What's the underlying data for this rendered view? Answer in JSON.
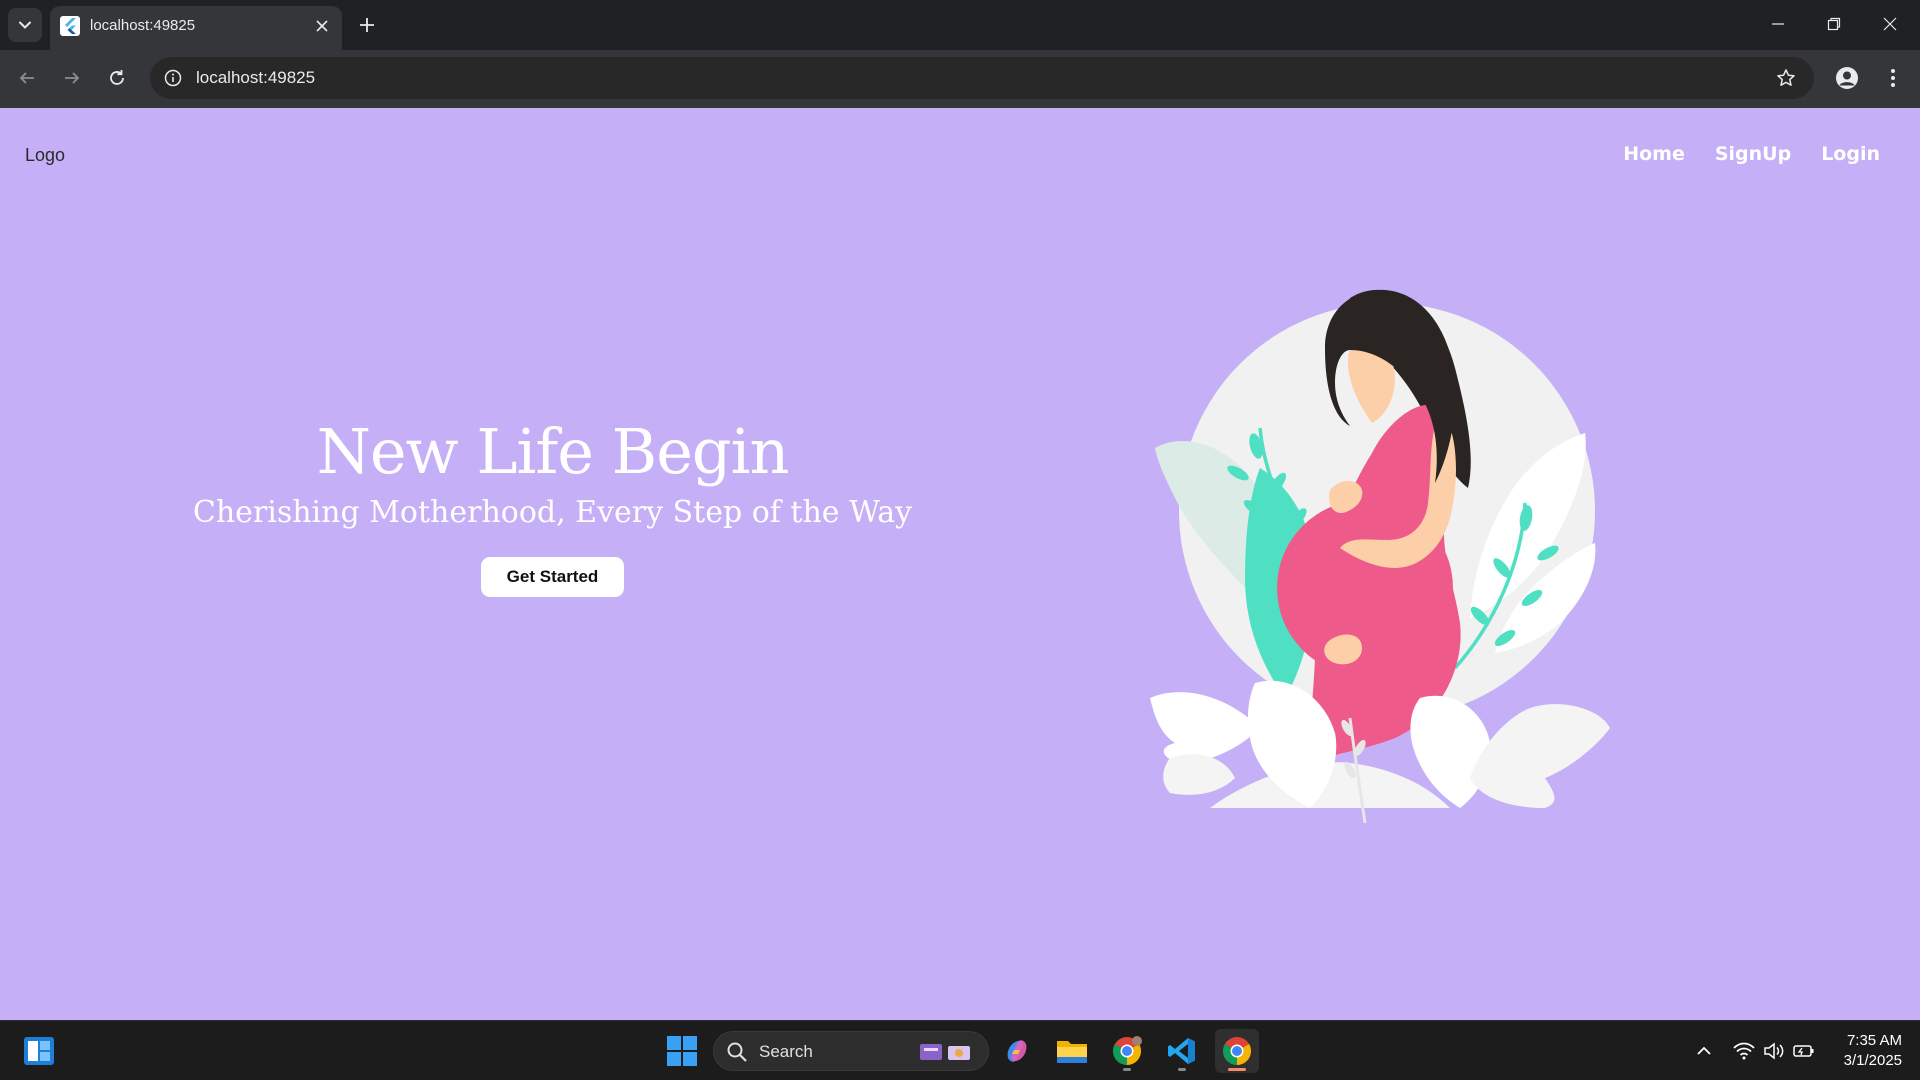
{
  "browser": {
    "tab": {
      "title": "localhost:49825"
    },
    "address_bar": {
      "url": "localhost:49825"
    }
  },
  "page": {
    "logo_text": "Logo",
    "nav": [
      {
        "label": "Home"
      },
      {
        "label": "SignUp"
      },
      {
        "label": "Login"
      }
    ],
    "hero": {
      "title": "New Life Begin",
      "subtitle": "Cherishing Motherhood, Every Step of the Way",
      "cta_label": "Get Started"
    },
    "colors": {
      "background": "#c5b0f7",
      "dress": "#ee5a8a",
      "leaf_teal": "#4fe0c4",
      "hair": "#2a2423",
      "skin": "#fccfa8"
    }
  },
  "taskbar": {
    "search_label": "Search",
    "clock_time": "7:35 AM",
    "clock_date": "3/1/2025",
    "pinned_apps": [
      "copilot-icon",
      "file-explorer-icon",
      "chrome-icon",
      "vscode-icon",
      "chrome-icon"
    ]
  }
}
